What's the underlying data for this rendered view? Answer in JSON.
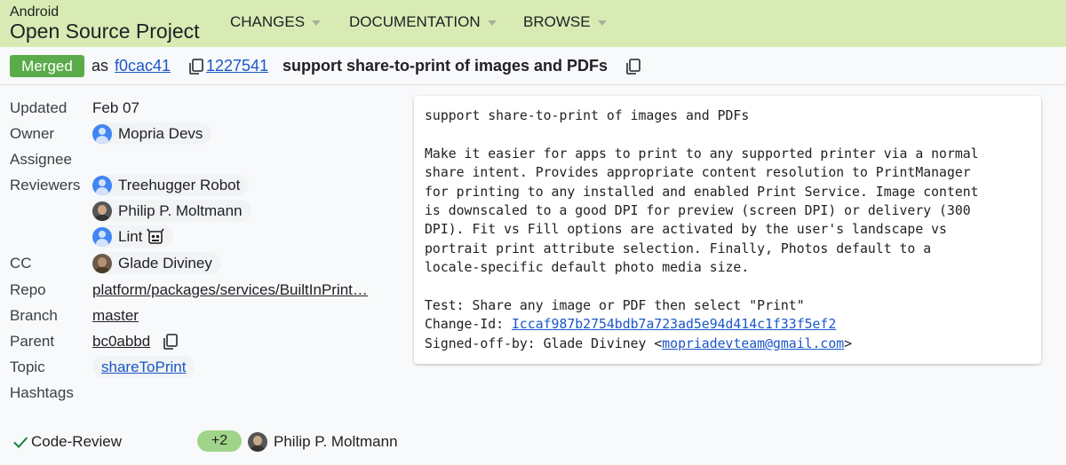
{
  "header": {
    "brand_small": "Android",
    "brand_large": "Open Source Project",
    "nav": [
      "CHANGES",
      "DOCUMENTATION",
      "BROWSE"
    ]
  },
  "change": {
    "status": "Merged",
    "as_label": "as",
    "commit_short": "f0cac41",
    "change_number": "1227541",
    "subject": "support share-to-print of images and PDFs"
  },
  "info": {
    "updated_label": "Updated",
    "updated_value": "Feb 07",
    "owner_label": "Owner",
    "owner_name": "Mopria Devs",
    "assignee_label": "Assignee",
    "reviewers_label": "Reviewers",
    "reviewers": [
      "Treehugger Robot",
      "Philip P. Moltmann",
      "Lint"
    ],
    "cc_label": "CC",
    "cc_name": "Glade Diviney",
    "repo_label": "Repo",
    "repo_value": "platform/packages/services/BuiltInPrint…",
    "branch_label": "Branch",
    "branch_value": "master",
    "parent_label": "Parent",
    "parent_value": "bc0abbd",
    "topic_label": "Topic",
    "topic_value": "shareToPrint",
    "hashtags_label": "Hashtags"
  },
  "commit_message": {
    "line1": "support share-to-print of images and PDFs",
    "body": "Make it easier for apps to print to any supported printer via a normal\nshare intent. Provides appropriate content resolution to PrintManager\nfor printing to any installed and enabled Print Service. Image content\nis downscaled to a good DPI for preview (screen DPI) or delivery (300\nDPI). Fit vs Fill options are activated by the user's landscape vs\nportrait print attribute selection. Finally, Photos default to a\nlocale-specific default photo media size.",
    "test_line": "Test: Share any image or PDF then select \"Print\"",
    "change_id_label": "Change-Id: ",
    "change_id": "Iccaf987b2754bdb7a723ad5e94d414c1f33f5ef2",
    "signed_off_label": "Signed-off-by: Glade Diviney <",
    "signed_off_email": "mopriadevteam@gmail.com",
    "signed_off_close": ">"
  },
  "votes": {
    "label": "Code-Review",
    "value": "+2",
    "voter": "Philip P. Moltmann"
  },
  "colors": {
    "header_bg": "#d9ebb4",
    "merged": "#5aab4a",
    "link": "#1a56c9",
    "vote_pill": "#9fd48a"
  }
}
